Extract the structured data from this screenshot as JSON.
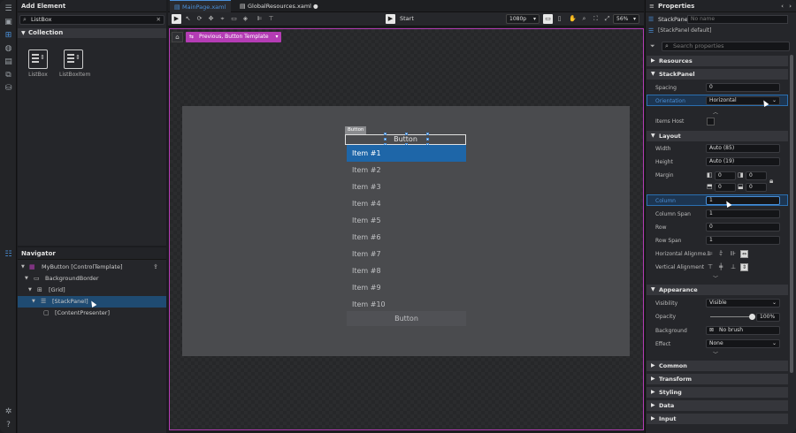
{
  "left_panel": {
    "title": "Add Element",
    "search_value": "ListBox",
    "collection_label": "Collection",
    "tiles": [
      "ListBox",
      "ListBoxItem"
    ]
  },
  "navigator": {
    "title": "Navigator",
    "rows": [
      "MyButton [ControlTemplate]",
      "BackgroundBorder",
      "[Grid]",
      "[StackPanel]",
      "[ContentPresenter]"
    ]
  },
  "tabs": [
    {
      "label": "MainPage.xaml"
    },
    {
      "label": "GlobalResources.xaml"
    }
  ],
  "toolbar": {
    "start_label": "Start",
    "resolution": "1080p",
    "zoom": "56%"
  },
  "canvas": {
    "breadcrumb": "Previous, Button Template",
    "button_label": "Button",
    "button_text": "Button",
    "items": [
      "Item #1",
      "Item #2",
      "Item #3",
      "Item #4",
      "Item #5",
      "Item #6",
      "Item #7",
      "Item #8",
      "Item #9",
      "Item #10"
    ],
    "bottom_button": "Button"
  },
  "properties": {
    "title": "Properties",
    "type_name": "StackPanel",
    "name_placeholder": "No name",
    "default_label": "[StackPanel default]",
    "search_placeholder": "Search properties",
    "sections": {
      "resources": "Resources",
      "stackpanel": "StackPanel",
      "layout": "Layout",
      "appearance": "Appearance",
      "common": "Common",
      "transform": "Transform",
      "styling": "Styling",
      "data": "Data",
      "input": "Input"
    },
    "labels": {
      "spacing": "Spacing",
      "orientation": "Orientation",
      "items_host": "Items Host",
      "width": "Width",
      "height": "Height",
      "margin": "Margin",
      "column": "Column",
      "column_span": "Column Span",
      "row": "Row",
      "row_span": "Row Span",
      "h_align": "Horizontal Alignme...",
      "v_align": "Vertical Alignment",
      "visibility": "Visibility",
      "opacity": "Opacity",
      "background": "Background",
      "effect": "Effect"
    },
    "values": {
      "spacing": "0",
      "orientation": "Horizontal",
      "width": "Auto (85)",
      "height": "Auto (19)",
      "margin_l": "0",
      "margin_r": "0",
      "margin_t": "0",
      "margin_b": "0",
      "column": "1",
      "column_span": "1",
      "row": "0",
      "row_span": "1",
      "visibility": "Visible",
      "opacity": "100%",
      "background": "No brush",
      "effect": "None"
    },
    "opacity_fraction": 1.0
  }
}
